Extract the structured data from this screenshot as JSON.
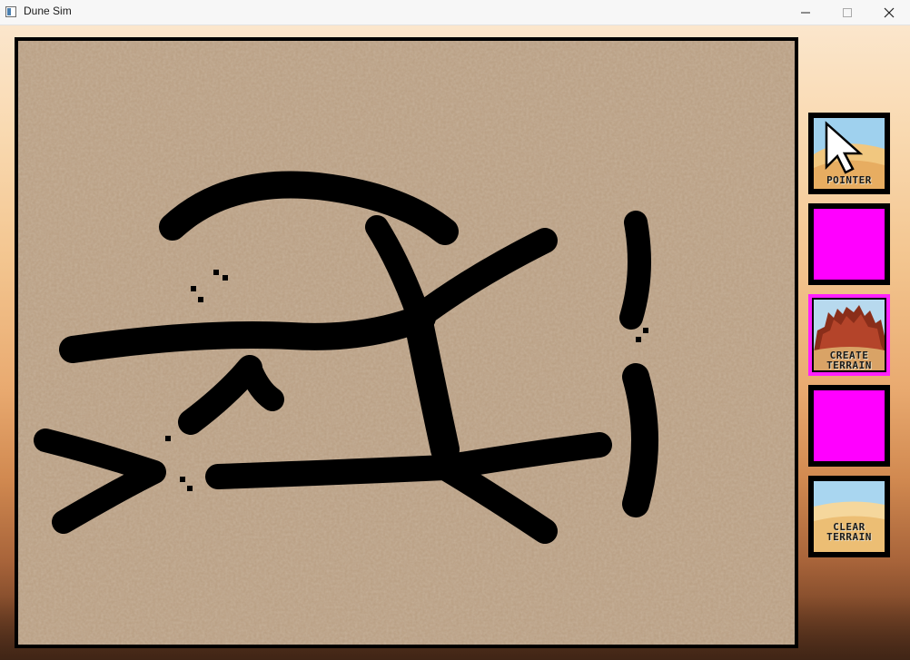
{
  "window": {
    "title": "Dune Sim",
    "app_icon": "window-app-icon",
    "controls": [
      "minimize-icon",
      "maximize-icon",
      "close-icon"
    ]
  },
  "map": {
    "sand_color": "#b7a08a",
    "terrain_color": "#000000"
  },
  "toolbar": {
    "tools": [
      {
        "id": "pointer",
        "label_line1": "POINTER",
        "label_line2": "",
        "icon": "cursor-arrow-icon",
        "selected": false
      },
      {
        "id": "empty-slot-1",
        "label_line1": "",
        "label_line2": "",
        "icon": "",
        "selected": false
      },
      {
        "id": "create-terrain",
        "label_line1": "CREATE",
        "label_line2": "TERRAIN",
        "icon": "rock-formation-icon",
        "selected": true
      },
      {
        "id": "empty-slot-2",
        "label_line1": "",
        "label_line2": "",
        "icon": "",
        "selected": false
      },
      {
        "id": "clear-terrain",
        "label_line1": "CLEAR",
        "label_line2": "TERRAIN",
        "icon": "sky-desert-icon",
        "selected": false
      }
    ],
    "selected_border_color": "#ff1fff",
    "empty_slot_color": "#ff00ff"
  }
}
